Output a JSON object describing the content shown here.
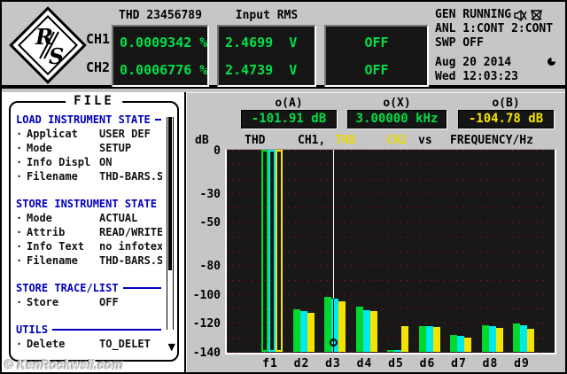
{
  "top_bar": {
    "logo": {
      "letter_r": "R",
      "letter_s": "S"
    },
    "channel_labels": [
      "CH1",
      "CH2"
    ],
    "displays": [
      {
        "header": "THD 23456789",
        "rows": [
          "0.0009342 %",
          "0.0006776 %"
        ],
        "color": "#00e046"
      },
      {
        "header": "Input RMS",
        "rows": [
          "2.4699  V",
          "2.4739  V"
        ],
        "color": "#00e046"
      },
      {
        "header": "",
        "rows": [
          "OFF",
          "OFF"
        ],
        "color": "#00e046"
      }
    ],
    "status": {
      "gen": "GEN RUNNING",
      "anl": "ANL 1:CONT 2:CONT",
      "swp": "SWP OFF",
      "date": "Aug 20 2014",
      "time": "Wed 12:03:23"
    },
    "icons": {
      "speaker_muted": "crossed-speaker",
      "monitor_muted": "crossed-monitor",
      "busy": "pie-clock"
    }
  },
  "file_panel": {
    "title": "FILE",
    "bullet": "·",
    "scroll_down_glyph": "▼",
    "sections": [
      {
        "header": "LOAD INSTRUMENT STATE",
        "items": [
          [
            "Applicat",
            "USER DEF"
          ],
          [
            "Mode",
            "SETUP"
          ],
          [
            "Info Displ",
            "ON"
          ],
          [
            "Filename",
            "THD-BARS.SA"
          ]
        ]
      },
      {
        "header": "STORE INSTRUMENT STATE",
        "items": [
          [
            "Mode",
            "ACTUAL"
          ],
          [
            "Attrib",
            "READ/WRITE"
          ],
          [
            "Info Text",
            "no infotext"
          ],
          [
            "Filename",
            "THD-BARS.SA"
          ]
        ]
      },
      {
        "header": "STORE TRACE/LIST",
        "items": [
          [
            "Store",
            "OFF"
          ]
        ]
      },
      {
        "header": "UTILS",
        "items": [
          [
            "Delete",
            "TO_DELET"
          ]
        ]
      }
    ]
  },
  "chart_panel": {
    "cursor_readouts": [
      {
        "label": "o(A)",
        "value": "-101.91 dB",
        "color": "#00e046"
      },
      {
        "label": "o(X)",
        "value": "3.00000 kHz",
        "color": "#00e046"
      },
      {
        "label": "o(B)",
        "value": "-104.78 dB",
        "color": "#f3e300"
      }
    ],
    "plot_title": {
      "unit": "dB",
      "seg_thd1": "THD",
      "seg_ch1": "CH1,",
      "seg_thd2": "THD",
      "seg_ch2": "CH2",
      "seg_vs": "vs",
      "seg_x": "FREQUENCY/Hz"
    }
  },
  "watermark": "© KenRockwell.com",
  "chart_data": {
    "type": "bar",
    "title": "THD CH1, THD CH2 vs FREQUENCY/Hz",
    "ylabel": "dB",
    "xlabel": "FREQUENCY/Hz",
    "ylim": [
      -140,
      0
    ],
    "ytick_labels": [
      0,
      -30,
      -50,
      -80,
      -100,
      -120,
      -140
    ],
    "grid": "red dotted horizontal lines every 10 dB",
    "legend_position": "title row (CH1 black/green bars, CH2 yellow bars)",
    "categories": [
      "f1",
      "d2",
      "d3",
      "d4",
      "d5",
      "d6",
      "d7",
      "d8",
      "d9"
    ],
    "series": [
      {
        "name": "CH1 green",
        "color": "#00d830",
        "values": [
          0,
          -110.5,
          -101.9,
          -108.5,
          -139,
          -122,
          -128.5,
          -121.5,
          -120.5
        ]
      },
      {
        "name": "CH1 cyan overlay",
        "color": "#00e8e8",
        "values": [
          0,
          -112,
          -103,
          -111,
          -139,
          -122.5,
          -129,
          -122,
          -121.5
        ]
      },
      {
        "name": "CH2 yellow",
        "color": "#f3e300",
        "values": [
          0,
          -113,
          -104.8,
          -112,
          -122,
          -123,
          -130,
          -123.5,
          -124
        ]
      }
    ],
    "cursor": {
      "x": "d3",
      "frequency": "3.00000 kHz",
      "oA": "-101.91 dB",
      "oB": "-104.78 dB"
    }
  }
}
